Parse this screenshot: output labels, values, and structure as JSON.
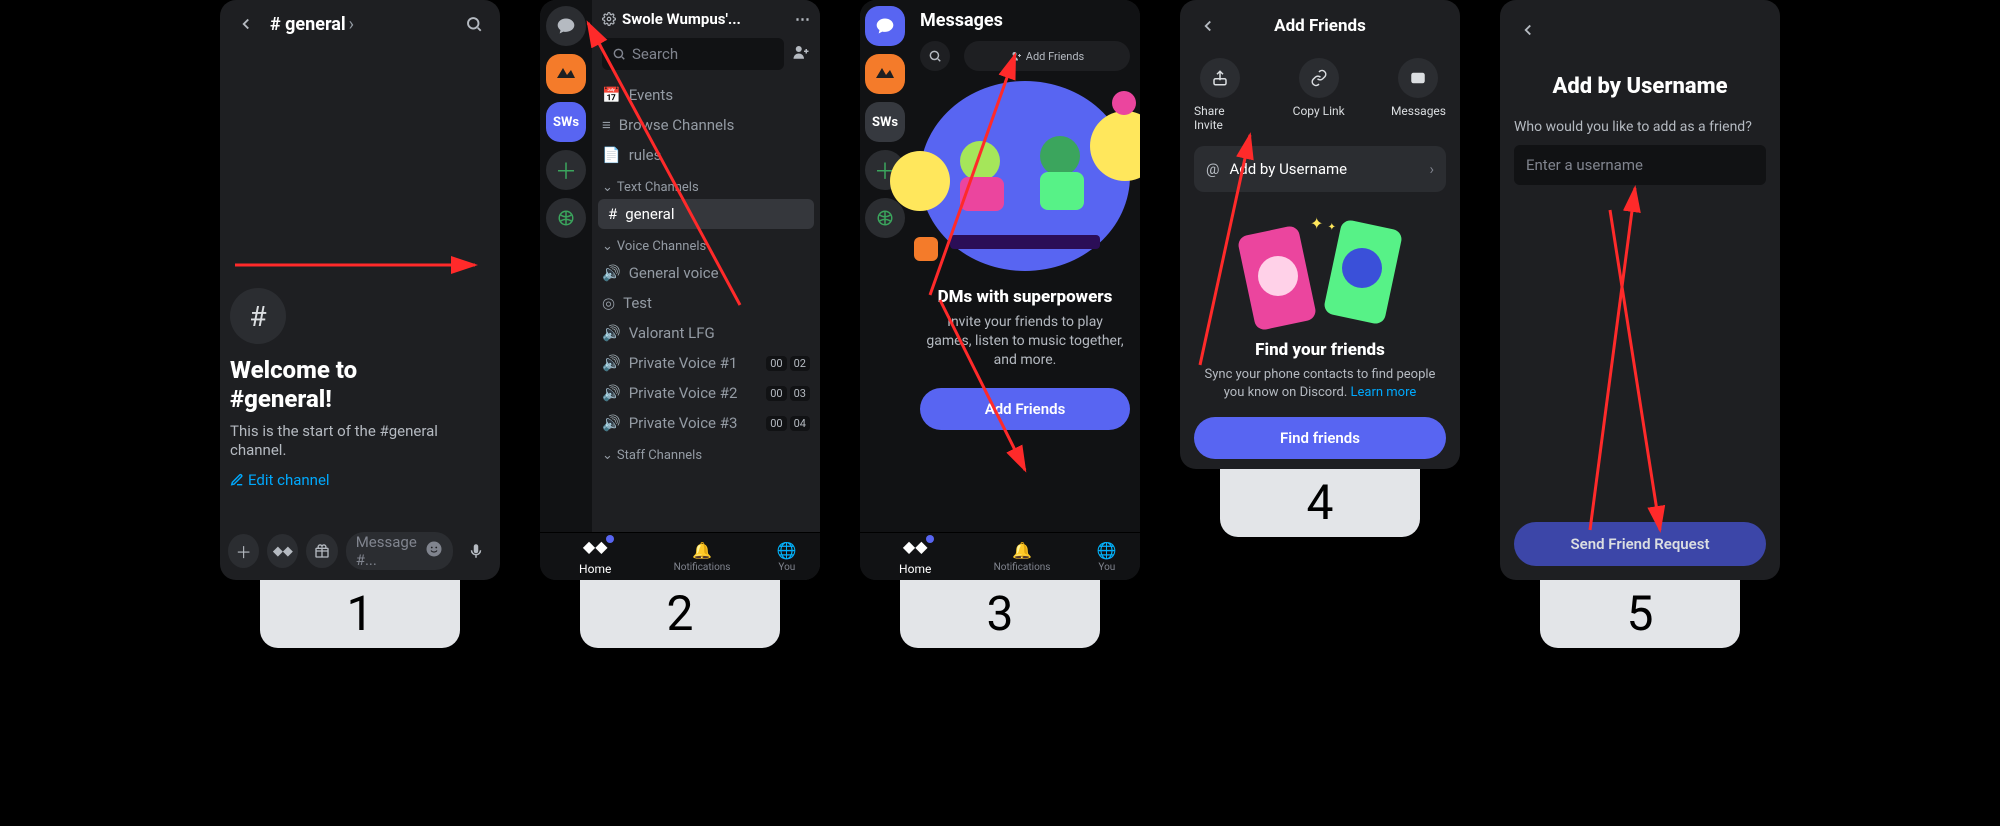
{
  "step_numbers": [
    "1",
    "2",
    "3",
    "4",
    "5"
  ],
  "panel1": {
    "channel_name": "# general",
    "chevron": "›",
    "hash": "#",
    "welcome_line1": "Welcome to",
    "welcome_line2": "#general!",
    "sub": "This is the start of the #general channel.",
    "edit": "Edit channel",
    "composer_placeholder": "Message #..."
  },
  "panel2": {
    "server_name": "Swole Wumpus'...",
    "search_placeholder": "Search",
    "server_badge": "SWs",
    "top_items": [
      "Events",
      "Browse Channels",
      "rules"
    ],
    "sections": [
      {
        "title": "Text Channels",
        "items": [
          {
            "icon": "#",
            "name": "general",
            "sel": true
          }
        ]
      },
      {
        "title": "Voice Channels",
        "items": [
          {
            "icon": "🔊",
            "name": "General voice"
          },
          {
            "icon": "◎",
            "name": "Test"
          },
          {
            "icon": "🔊",
            "name": "Valorant LFG"
          },
          {
            "icon": "🔊",
            "name": "Private Voice #1",
            "tags": [
              "00",
              "02"
            ]
          },
          {
            "icon": "🔊",
            "name": "Private Voice #2",
            "tags": [
              "00",
              "03"
            ]
          },
          {
            "icon": "🔊",
            "name": "Private Voice #3",
            "tags": [
              "00",
              "04"
            ]
          }
        ]
      },
      {
        "title": "Staff Channels",
        "items": []
      }
    ],
    "nav": {
      "home": "Home",
      "notif": "Notifications",
      "you": "You"
    }
  },
  "panel3": {
    "title": "Messages",
    "add_friends_pill": "Add Friends",
    "dm_title": "DMs with superpowers",
    "dm_sub": "Invite your friends to play games, listen to music together, and more.",
    "cta": "Add Friends",
    "server_badge": "SWs"
  },
  "panel4": {
    "title": "Add Friends",
    "actions": [
      {
        "icon": "share",
        "label": "Share Invite"
      },
      {
        "icon": "link",
        "label": "Copy Link"
      },
      {
        "icon": "msg",
        "label": "Messages"
      }
    ],
    "add_by_username": "Add by Username",
    "find_title": "Find your friends",
    "find_sub_1": "Sync your phone contacts to find people you know on Discord. ",
    "learn_more": "Learn more",
    "find_btn": "Find friends"
  },
  "panel5": {
    "title": "Add by Username",
    "sub": "Who would you like to add as a friend?",
    "placeholder": "Enter a username",
    "send": "Send Friend Request"
  }
}
